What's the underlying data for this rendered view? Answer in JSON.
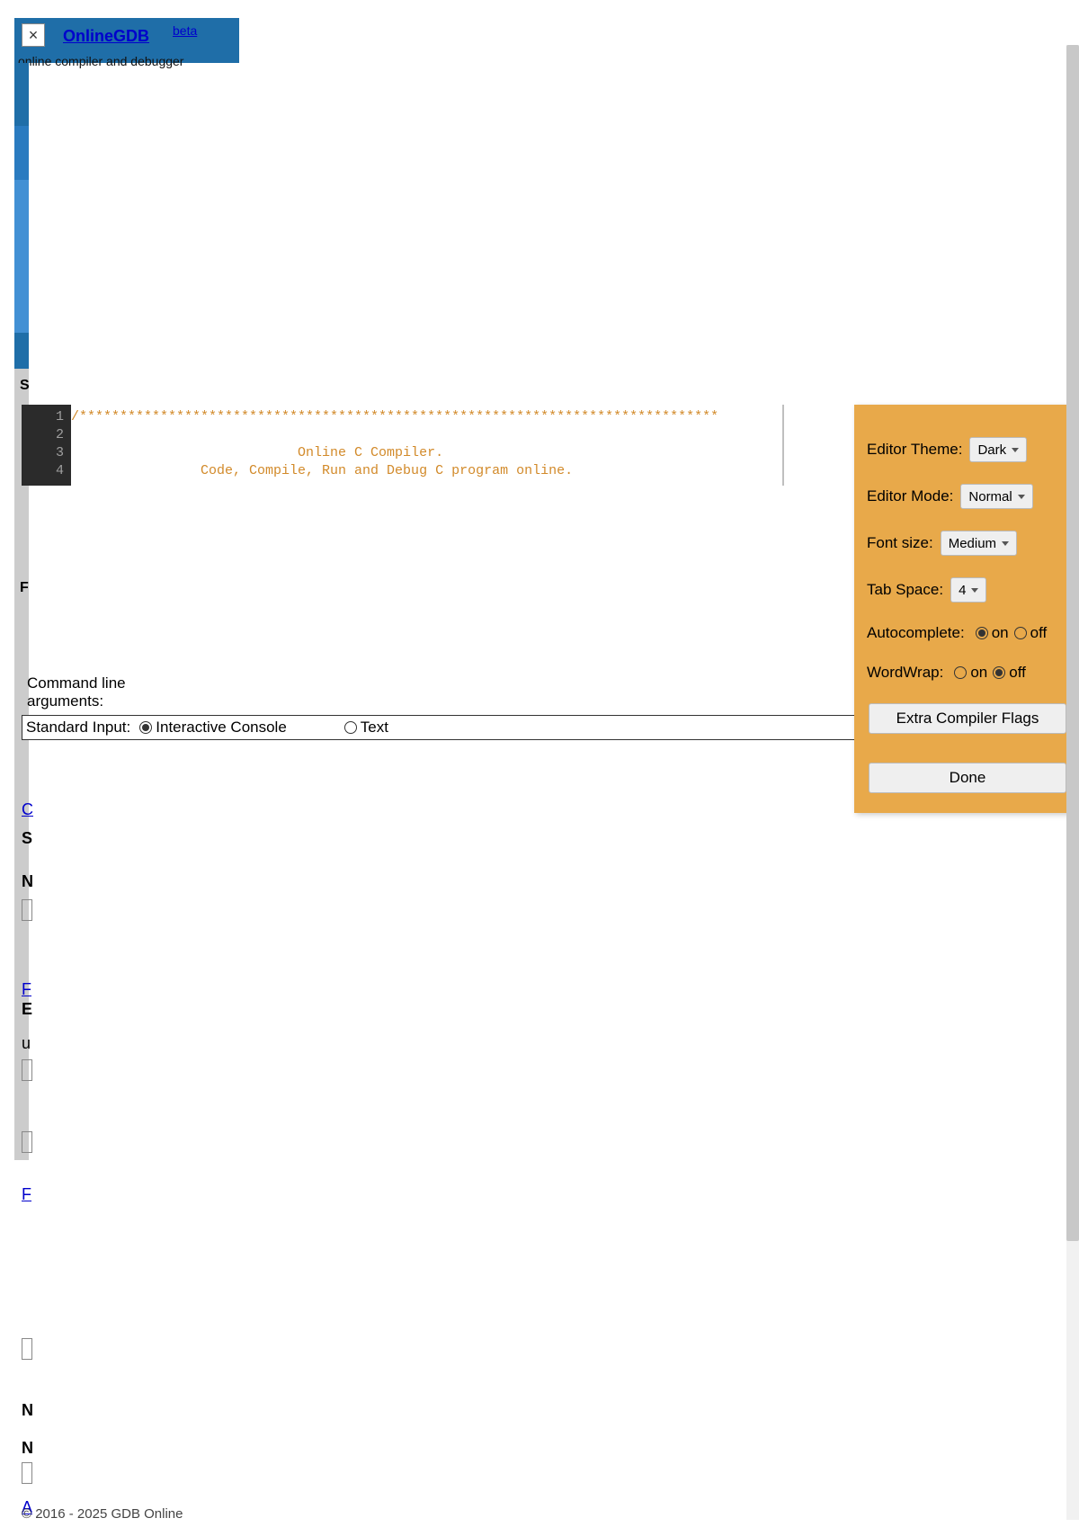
{
  "header": {
    "close_glyph": "×",
    "logo": "OnlineGDB",
    "beta": "beta",
    "tagline": "online compiler and debugger"
  },
  "editor": {
    "line_numbers": [
      "1",
      "2",
      "3",
      "4"
    ],
    "code_line1": "/*******************************************************************************",
    "code_line2": "",
    "code_line3": "                            Online C Compiler.",
    "code_line4": "                Code, Compile, Run and Debug C program online."
  },
  "cmd": {
    "label": "Command line arguments:",
    "stdin_label": "Standard Input:",
    "interactive": "Interactive Console",
    "text": "Text"
  },
  "settings": {
    "theme_label": "Editor Theme:",
    "theme_value": "Dark",
    "mode_label": "Editor Mode:",
    "mode_value": "Normal",
    "font_label": "Font size:",
    "font_value": "Medium",
    "tab_label": "Tab Space:",
    "tab_value": "4",
    "ac_label": "Autocomplete:",
    "ww_label": "WordWrap:",
    "on": "on",
    "off": "off",
    "flags_button": "Extra Compiler Flags",
    "done_button": "Done"
  },
  "footer": {
    "about_link": "A",
    "copyright": "© 2016 - 2025 GDB Online"
  },
  "stubs": {
    "s1": "S",
    "f1": "F",
    "c_link": "C",
    "s2": "S",
    "n1": "N",
    "f_link": "F",
    "e_bold": "E",
    "u1": "u",
    "f_link2": "F",
    "n2": "N",
    "n3": "N"
  }
}
